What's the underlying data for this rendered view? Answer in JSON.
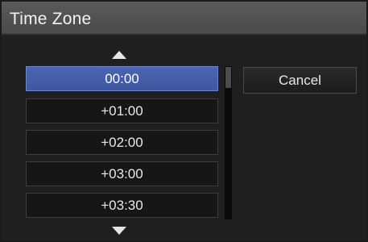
{
  "dialog": {
    "title": "Time Zone",
    "cancel_label": "Cancel"
  },
  "timezones": {
    "items": [
      "00:00",
      "+01:00",
      "+02:00",
      "+03:00",
      "+03:30"
    ],
    "selected": "00:00"
  },
  "icons": {
    "scroll_up": "triangle-up-icon",
    "scroll_down": "triangle-down-icon"
  },
  "colors": {
    "selected_background": "#4a65b3",
    "dialog_background": "#1f1f1f",
    "titlebar_background": "#555555"
  }
}
